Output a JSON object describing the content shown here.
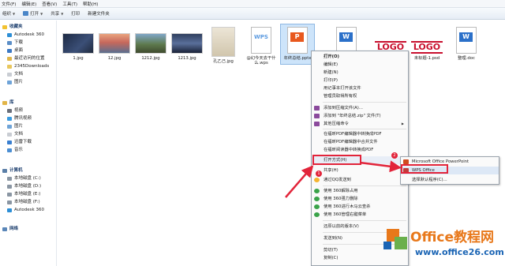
{
  "menubar": {
    "items": [
      "文件(F)",
      "编辑(E)",
      "查看(V)",
      "工具(T)",
      "帮助(H)"
    ]
  },
  "toolbar": {
    "organize": "组织",
    "open": "打开",
    "share": "共享",
    "print": "打印",
    "new_folder": "新建文件夹"
  },
  "nav": {
    "favorites": {
      "label": "收藏夹",
      "items": [
        "Autodesk 360",
        "下载",
        "桌面",
        "最近访问的位置",
        "2345Downloads",
        "文档",
        "图片"
      ]
    },
    "libraries": {
      "label": "库",
      "items": [
        "视频",
        "腾讯视频",
        "图片",
        "文档",
        "迅雷下载",
        "音乐"
      ]
    },
    "computer": {
      "label": "计算机",
      "items": [
        "本地磁盘 (C:)",
        "本地磁盘 (D:)",
        "本地磁盘 (E:)",
        "本地磁盘 (F:)",
        "Autodesk 360"
      ]
    },
    "network": {
      "label": "网络"
    }
  },
  "files": [
    {
      "name": "1.jpg",
      "kind": "photo"
    },
    {
      "name": "12.jpg",
      "kind": "photo"
    },
    {
      "name": "1212.jpg",
      "kind": "photo"
    },
    {
      "name": "1213.jpg",
      "kind": "photo"
    },
    {
      "name": "孔乙己.jpg",
      "kind": "photo"
    },
    {
      "name": "@幻今天去干什么.wps",
      "kind": "wps",
      "badge": "WPS"
    },
    {
      "name": "年终总结.pptx",
      "kind": "pptx",
      "badge": "P"
    },
    {
      "name": "",
      "kind": "docx",
      "badge": "W"
    },
    {
      "name": "",
      "kind": "logo",
      "badge": "LOGO"
    },
    {
      "name": "未标题-1.psd",
      "kind": "logo",
      "badge": "LOGO"
    },
    {
      "name": "整理.doc",
      "kind": "doc",
      "badge": "W"
    }
  ],
  "context_menu": {
    "items": [
      "打开(O)",
      "编辑(E)",
      "新建(N)",
      "打印(P)",
      "用记事本打开该文件",
      "管理员取得所有权",
      "添加到压缩文件(A)...",
      "添加到 \"年终总结.zip\" 文件(T)",
      "其他压缩命令",
      "在福昕PDF编辑器中转换成PDF",
      "在福昕PDF编辑器中合并文件",
      "在福昕阅读器中转换成PDF",
      "打开方式(H)",
      "共享(H)",
      "通过QQ发送到",
      "使用 360解除占用",
      "使用 360强力删除",
      "使用 360进行木马云查杀",
      "使用 360管理右键菜单",
      "还原以前的版本(V)",
      "发送到(N)",
      "剪切(T)",
      "复制(C)"
    ]
  },
  "submenu": {
    "items": [
      "Microsoft Office PowerPoint",
      "WPS Office",
      "选择默认程序(C)..."
    ]
  },
  "badges": [
    "1",
    "2"
  ],
  "watermark": {
    "office": "Office教程网",
    "site": "www.office26.com"
  }
}
